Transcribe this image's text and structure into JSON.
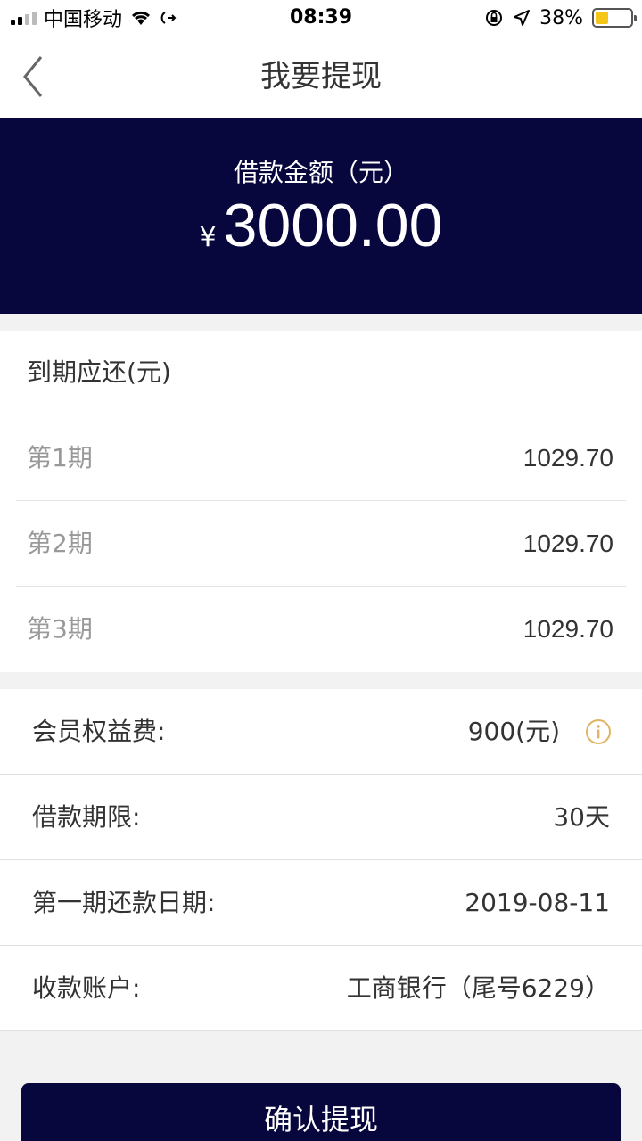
{
  "status_bar": {
    "carrier": "中国移动",
    "time": "08:39",
    "battery": "38%",
    "battery_level": 0.38
  },
  "nav": {
    "title": "我要提现"
  },
  "banner": {
    "label": "借款金额（元）",
    "currency": "¥",
    "amount": "3000.00",
    "background": "#07063d"
  },
  "repayment": {
    "header": "到期应还(元)",
    "installments": [
      {
        "label": "第1期",
        "value": "1029.70"
      },
      {
        "label": "第2期",
        "value": "1029.70"
      },
      {
        "label": "第3期",
        "value": "1029.70"
      }
    ]
  },
  "details": {
    "rows": [
      {
        "label": "会员权益费:",
        "value": "900(元)"
      },
      {
        "label": "借款期限:",
        "value": "30天"
      },
      {
        "label": "第一期还款日期:",
        "value": "2019-08-11"
      },
      {
        "label": "收款账户:",
        "value": "工商银行（尾号6229）"
      }
    ],
    "info_icon_color": "#e0b561"
  },
  "confirm_button": {
    "label": "确认提现"
  }
}
